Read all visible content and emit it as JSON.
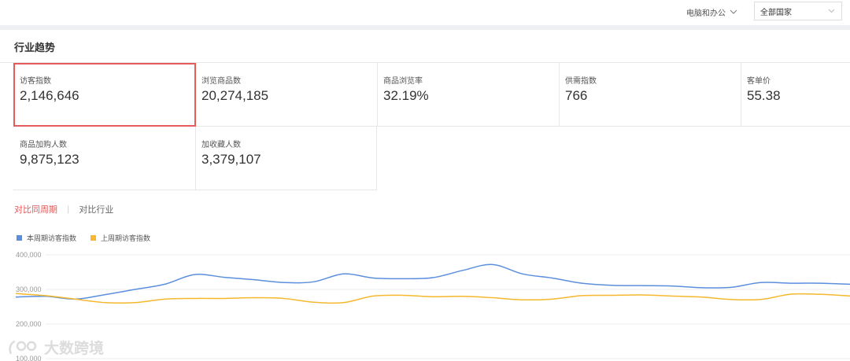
{
  "header": {
    "category": "电脑和办公",
    "country": "全部国家"
  },
  "section": {
    "title": "行业趋势"
  },
  "metrics": [
    {
      "label": "访客指数",
      "value": "2,146,646"
    },
    {
      "label": "浏览商品数",
      "value": "20,274,185"
    },
    {
      "label": "商品浏览率",
      "value": "32.19%"
    },
    {
      "label": "供需指数",
      "value": "766"
    },
    {
      "label": "客单价",
      "value": "55.38"
    },
    {
      "label": "商品加购人数",
      "value": "9,875,123"
    },
    {
      "label": "加收藏人数",
      "value": "3,379,107"
    }
  ],
  "compare": {
    "active": "对比同周期",
    "other": "对比行业"
  },
  "colors": {
    "current": "#5b8fde",
    "previous": "#f5b82e",
    "active_red": "#e55b5b"
  },
  "watermark": {
    "text": "大数跨境"
  },
  "chart_data": {
    "type": "line",
    "ylim": [
      100000,
      400000
    ],
    "yticks": [
      "400,000",
      "300,000",
      "200,000",
      "100,000"
    ],
    "ytick_values": [
      400000,
      300000,
      200000,
      100000
    ],
    "grid": true,
    "legend_position": "top-left",
    "series": [
      {
        "name": "本周期访客指数",
        "color": "#5b8fde",
        "values": [
          278000,
          280000,
          272000,
          285000,
          300000,
          315000,
          343000,
          335000,
          328000,
          320000,
          322000,
          345000,
          333000,
          331000,
          334000,
          355000,
          372000,
          345000,
          333000,
          318000,
          312000,
          311000,
          310000,
          305000,
          306000,
          320000,
          318000,
          318000,
          315000
        ]
      },
      {
        "name": "上周期访客指数",
        "color": "#f5b82e",
        "values": [
          288000,
          282000,
          272000,
          262000,
          262000,
          272000,
          274000,
          274000,
          276000,
          274000,
          263000,
          262000,
          281000,
          283000,
          279000,
          280000,
          276000,
          270000,
          272000,
          282000,
          283000,
          284000,
          281000,
          278000,
          271000,
          271000,
          286000,
          286000,
          281000
        ]
      }
    ]
  }
}
